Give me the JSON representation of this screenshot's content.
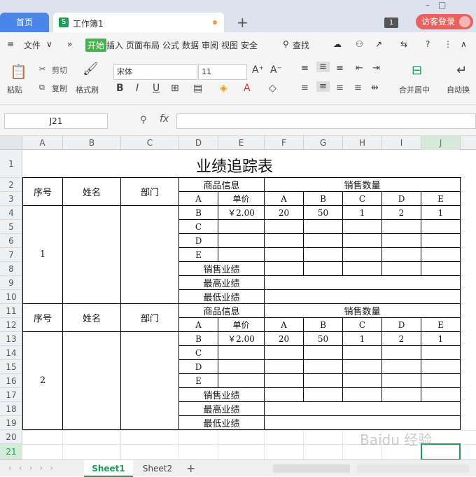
{
  "tabs": {
    "home": "首页",
    "doc": "工作簿1",
    "badge": "1",
    "visitor": "访客登录"
  },
  "menu": {
    "file": "文件",
    "items": [
      "开始",
      "插入",
      "页面布局",
      "公式",
      "数据",
      "审阅",
      "视图",
      "安全"
    ],
    "search": "查找"
  },
  "ribbon": {
    "paste": "粘贴",
    "cut": "剪切",
    "copy": "复制",
    "format_painter": "格式刷",
    "font": "宋体",
    "size": "11",
    "bold": "B",
    "italic": "I",
    "underline": "U",
    "merge": "合并居中",
    "wrap": "自动换"
  },
  "formula": {
    "cell_ref": "J21",
    "fx": "fx"
  },
  "columns": [
    "A",
    "B",
    "C",
    "D",
    "E",
    "F",
    "G",
    "H",
    "I",
    "J"
  ],
  "rows": [
    "1",
    "2",
    "3",
    "4",
    "5",
    "6",
    "7",
    "8",
    "9",
    "10",
    "11",
    "12",
    "13",
    "14",
    "15",
    "16",
    "17",
    "18",
    "19",
    "20",
    "21"
  ],
  "sheet": {
    "title": "业绩追踪表",
    "h_seq": "序号",
    "h_name": "姓名",
    "h_dept": "部门",
    "h_goods": "商品信息",
    "h_sales": "销售数量",
    "sub_a": "A",
    "sub_price": "单价",
    "sales_cols": [
      "A",
      "B",
      "C",
      "D",
      "E"
    ],
    "goods": [
      "B",
      "C",
      "D",
      "E"
    ],
    "price": "￥2.00",
    "qty": [
      "20",
      "50",
      "1",
      "2",
      "1"
    ],
    "perf": "销售业绩",
    "max": "最高业绩",
    "min": "最低业绩",
    "seq1": "1",
    "seq2": "2"
  },
  "sheets": [
    "Sheet1",
    "Sheet2"
  ],
  "watermark": "Baidu 经验"
}
